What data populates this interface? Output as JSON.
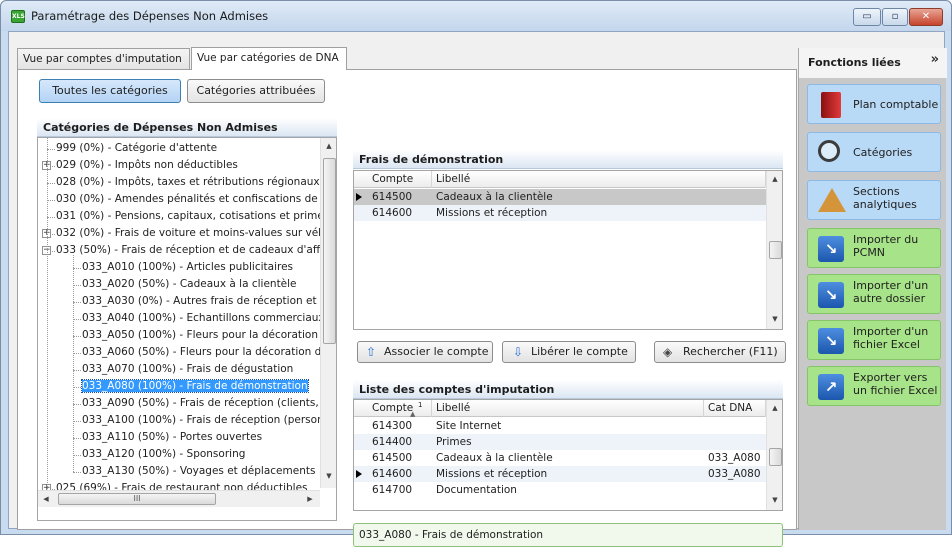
{
  "window": {
    "title": "Paramétrage des Dépenses Non Admises",
    "app_icon": "spreadsheet-icon",
    "minimize_glyph": "▭",
    "maximize_glyph": "▫",
    "close_glyph": "✕"
  },
  "tabs": [
    {
      "label": "Vue par comptes d'imputation",
      "active": false
    },
    {
      "label": "Vue par catégories de DNA",
      "active": true
    }
  ],
  "filter_buttons": {
    "all": "Toutes les catégories",
    "assigned": "Catégories attribuées"
  },
  "categories_panel": {
    "title": "Catégories de Dépenses Non Admises",
    "items": [
      {
        "label": "999 (0%) - Catégorie d'attente",
        "level": 0,
        "expander": ""
      },
      {
        "label": "029 (0%) - Impôts non déductibles",
        "level": 0,
        "expander": "+"
      },
      {
        "label": "028 (0%) - Impôts, taxes et rétributions régionaux",
        "level": 0,
        "expander": ""
      },
      {
        "label": "030 (0%) - Amendes pénalités et confiscations de t",
        "level": 0,
        "expander": ""
      },
      {
        "label": "031 (0%) - Pensions, capitaux, cotisations et primes",
        "level": 0,
        "expander": ""
      },
      {
        "label": "032 (0%) - Frais de voiture et moins-values sur véhi",
        "level": 0,
        "expander": "+"
      },
      {
        "label": "033 (50%) - Frais de réception et de cadeaux d'affa",
        "level": 0,
        "expander": "−"
      },
      {
        "label": "033_A010 (100%) - Articles publicitaires",
        "level": 1,
        "expander": ""
      },
      {
        "label": "033_A020 (50%) - Cadeaux à la clientèle",
        "level": 1,
        "expander": ""
      },
      {
        "label": "033_A030 (0%) - Autres frais de réception et de",
        "level": 1,
        "expander": ""
      },
      {
        "label": "033_A040 (100%) - Echantillons commerciaux",
        "level": 1,
        "expander": ""
      },
      {
        "label": "033_A050 (100%) - Fleurs pour la décoration d",
        "level": 1,
        "expander": ""
      },
      {
        "label": "033_A060 (50%) - Fleurs pour la décoration d'u",
        "level": 1,
        "expander": ""
      },
      {
        "label": "033_A070 (100%) - Frais de dégustation",
        "level": 1,
        "expander": ""
      },
      {
        "label": "033_A080 (100%) - Frais de démonstration",
        "level": 1,
        "expander": "",
        "selected": true
      },
      {
        "label": "033_A090 (50%) - Frais de réception (clients, p",
        "level": 1,
        "expander": ""
      },
      {
        "label": "033_A100 (100%) - Frais de réception (personr",
        "level": 1,
        "expander": ""
      },
      {
        "label": "033_A110 (50%) - Portes ouvertes",
        "level": 1,
        "expander": ""
      },
      {
        "label": "033_A120 (100%) - Sponsoring",
        "level": 1,
        "expander": ""
      },
      {
        "label": "033_A130 (50%) - Voyages et déplacements",
        "level": 1,
        "expander": ""
      },
      {
        "label": "025 (69%) - Frais de restaurant non déductibles",
        "level": 0,
        "expander": "+"
      }
    ],
    "hscroll_grip": "III"
  },
  "linked_accounts": {
    "title": "Frais de démonstration",
    "columns": [
      "Compte",
      "Libellé"
    ],
    "rows": [
      {
        "compte": "614500",
        "libelle": "Cadeaux à la clientèle",
        "current": true
      },
      {
        "compte": "614600",
        "libelle": "Missions et réception",
        "current": false
      }
    ]
  },
  "actions": {
    "associate": "Associer le compte",
    "release": "Libérer le compte",
    "search": "Rechercher (F11)"
  },
  "accounts_list": {
    "title": "Liste des comptes d'imputation",
    "columns": [
      "Compte",
      "Libellé",
      "Cat DNA"
    ],
    "sort_indicator": "1",
    "rows": [
      {
        "compte": "614300",
        "libelle": "Site Internet",
        "cat": "",
        "current": false
      },
      {
        "compte": "614400",
        "libelle": "Primes",
        "cat": "",
        "current": false
      },
      {
        "compte": "614500",
        "libelle": "Cadeaux à la clientèle",
        "cat": "033_A080",
        "current": false
      },
      {
        "compte": "614600",
        "libelle": "Missions et réception",
        "cat": "033_A080",
        "current": true
      },
      {
        "compte": "614700",
        "libelle": "Documentation",
        "cat": "",
        "current": false
      }
    ]
  },
  "status": "033_A080 - Frais de démonstration",
  "side_panel": {
    "title": "Fonctions liées",
    "collapse_glyph": "»",
    "buttons": [
      {
        "label": "Plan comptable",
        "icon": "book-icon",
        "color": "blue"
      },
      {
        "label": "Catégories",
        "icon": "magnifier-icon",
        "color": "blue"
      },
      {
        "label": "Sections analytiques",
        "icon": "pyramid-icon",
        "color": "blue"
      },
      {
        "label": "Importer du PCMN",
        "icon": "import-arrow-icon",
        "color": "green"
      },
      {
        "label": "Importer d'un autre dossier",
        "icon": "import-arrow-icon",
        "color": "green"
      },
      {
        "label": "Importer d'un fichier Excel",
        "icon": "import-arrow-icon",
        "color": "green"
      },
      {
        "label": "Exporter vers un fichier Excel",
        "icon": "export-arrow-icon",
        "color": "green"
      }
    ]
  }
}
